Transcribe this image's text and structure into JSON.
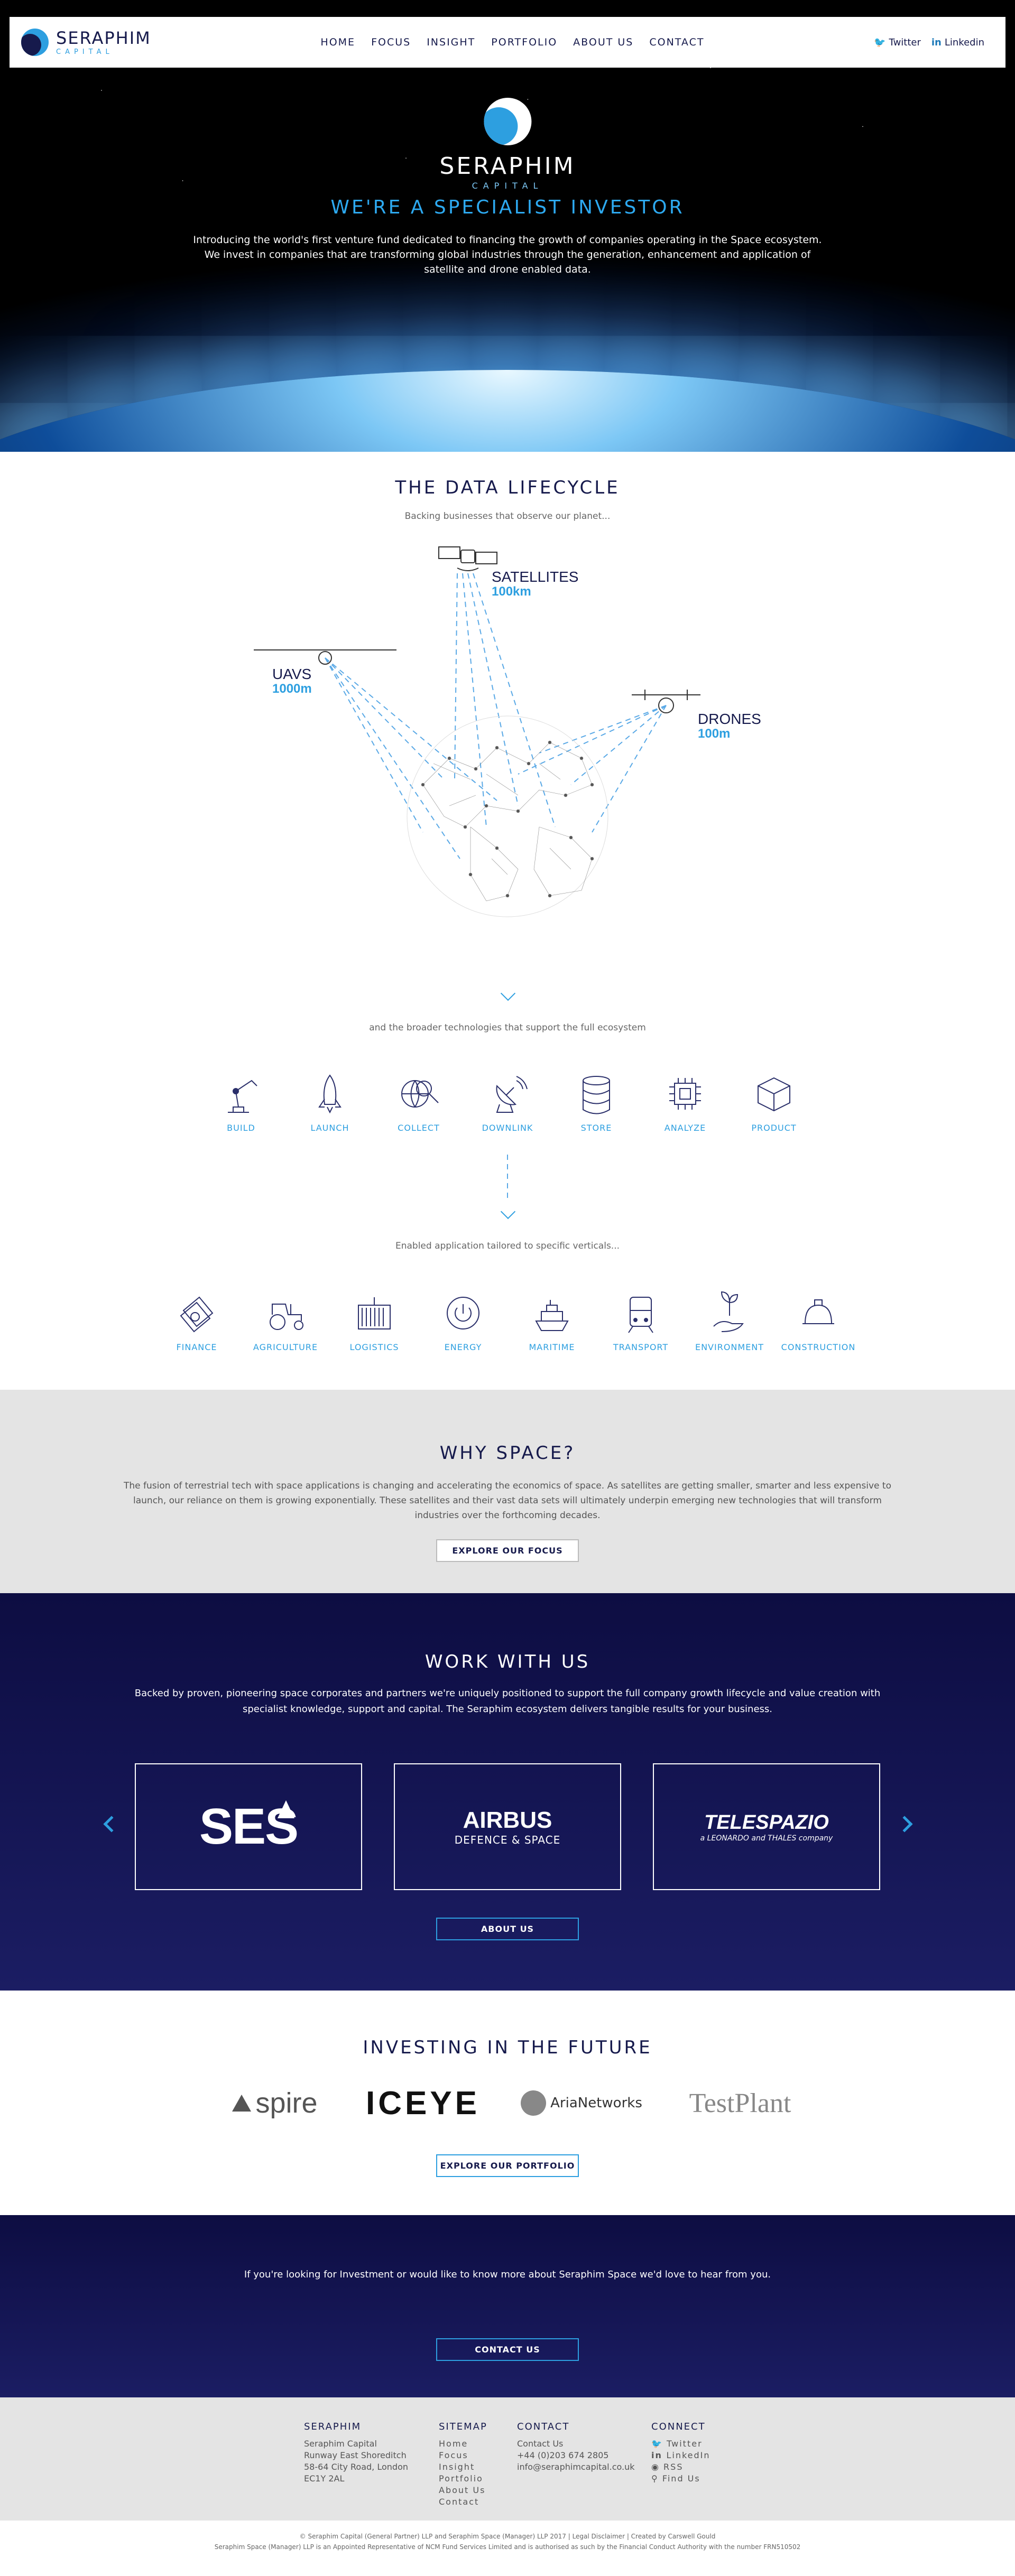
{
  "brand": {
    "name": "SERAPHIM",
    "tag": "CAPITAL"
  },
  "nav": [
    "HOME",
    "FOCUS",
    "INSIGHT",
    "PORTFOLIO",
    "ABOUT US",
    "CONTACT"
  ],
  "social": {
    "twitter": "Twitter",
    "linkedin": "Linkedin"
  },
  "hero": {
    "title": "WE'RE A SPECIALIST INVESTOR",
    "body": "Introducing the world's first venture fund dedicated to financing the growth of companies operating in the Space ecosystem. We invest in companies that are transforming global industries through the generation, enhancement and application of satellite and drone enabled data."
  },
  "lifecycle": {
    "title": "THE DATA LIFECYCLE",
    "sub1": "Backing businesses that observe our planet...",
    "nodes": [
      {
        "name": "SATELLITES",
        "dist": "100km"
      },
      {
        "name": "UAVS",
        "dist": "1000m"
      },
      {
        "name": "DRONES",
        "dist": "100m"
      }
    ],
    "sub2": "and the broader technologies that support the full ecosystem",
    "tech": [
      {
        "label": "BUILD",
        "icon": "robot-arm-icon"
      },
      {
        "label": "LAUNCH",
        "icon": "rocket-icon"
      },
      {
        "label": "COLLECT",
        "icon": "globe-magnifier-icon"
      },
      {
        "label": "DOWNLINK",
        "icon": "satellite-dish-icon"
      },
      {
        "label": "STORE",
        "icon": "database-icon"
      },
      {
        "label": "ANALYZE",
        "icon": "chip-icon"
      },
      {
        "label": "PRODUCT",
        "icon": "package-icon"
      }
    ],
    "sub3": "Enabled application tailored to specific verticals...",
    "verticals": [
      {
        "label": "FINANCE",
        "icon": "banknote-icon"
      },
      {
        "label": "AGRICULTURE",
        "icon": "tractor-icon"
      },
      {
        "label": "LOGISTICS",
        "icon": "container-icon"
      },
      {
        "label": "ENERGY",
        "icon": "power-icon"
      },
      {
        "label": "MARITIME",
        "icon": "ship-icon"
      },
      {
        "label": "TRANSPORT",
        "icon": "train-icon"
      },
      {
        "label": "ENVIRONMENT",
        "icon": "plant-hand-icon"
      },
      {
        "label": "CONSTRUCTION",
        "icon": "hardhat-icon"
      }
    ]
  },
  "why": {
    "title": "WHY SPACE?",
    "body": "The fusion of terrestrial tech with space applications is changing and accelerating the economics of space. As satellites are getting smaller, smarter and less expensive to launch, our reliance on them is growing exponentially. These satellites and their vast data sets will ultimately underpin emerging new technologies that will transform industries over the forthcoming decades.",
    "button": "EXPLORE OUR FOCUS"
  },
  "work": {
    "title": "WORK WITH US",
    "body": "Backed by proven, pioneering space corporates and partners we're uniquely positioned to support the full company growth lifecycle and value creation with specialist knowledge, support and capital. The Seraphim ecosystem delivers tangible results for your business.",
    "partners": [
      {
        "name": "SES",
        "sub": ""
      },
      {
        "name": "AIRBUS",
        "sub": "DEFENCE & SPACE"
      },
      {
        "name": "TELESPAZIO",
        "sub": "a LEONARDO and THALES company"
      }
    ],
    "button": "ABOUT US"
  },
  "invest": {
    "title": "INVESTING IN THE FUTURE",
    "logos": [
      "spire",
      "ICEYE",
      "AriaNetworks",
      "TestPlant"
    ],
    "button": "EXPLORE OUR PORTFOLIO"
  },
  "contact": {
    "body": "If you're looking for Investment or would like to know more about Seraphim Space we'd love to hear from you.",
    "button": "CONTACT US"
  },
  "footer": {
    "seraphim": {
      "title": "SERAPHIM",
      "lines": [
        "Seraphim Capital",
        "Runway East Shoreditch",
        "58-64 City Road, London",
        "EC1Y 2AL"
      ]
    },
    "sitemap": {
      "title": "SITEMAP",
      "links": [
        "Home",
        "Focus",
        "Insight",
        "Portfolio",
        "About Us",
        "Contact"
      ]
    },
    "contact": {
      "title": "CONTACT",
      "lines": [
        "Contact Us",
        "+44 (0)203 674 2805",
        "info@seraphimcapital.co.uk"
      ]
    },
    "connect": {
      "title": "CONNECT",
      "links": [
        "Twitter",
        "LinkedIn",
        "RSS",
        "Find Us"
      ]
    }
  },
  "legal": {
    "line1": "© Seraphim Capital (General Partner) LLP and Seraphim Space (Manager) LLP 2017 | Legal Disclaimer | Created by Carswell Gould",
    "line2": "Seraphim Space (Manager) LLP is an Appointed Representative of NCM Fund Services Limited and is authorised as such by the Financial Conduct Authority with the number FRN510502"
  },
  "colors": {
    "navy": "#161a4c",
    "accent": "#2d9fe0",
    "grey": "#e4e4e4"
  }
}
